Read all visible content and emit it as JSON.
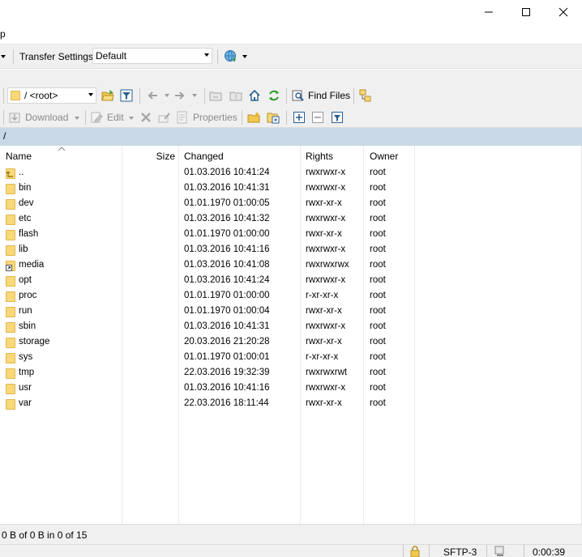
{
  "window": {
    "minimize_icon": "minimize-icon",
    "maximize_icon": "maximize-icon",
    "close_icon": "close-icon"
  },
  "menu": {
    "fragment": "p"
  },
  "toolbar_top": {
    "transfer_settings_label": "Transfer Settings",
    "transfer_preset": "Default"
  },
  "nav_toolbar": {
    "path_combo": "/ <root>",
    "find_files_label": "Find Files"
  },
  "file_toolbar": {
    "download_label": "Download",
    "edit_label": "Edit",
    "properties_label": "Properties"
  },
  "current_path": "/",
  "columns": {
    "name": "Name",
    "size": "Size",
    "changed": "Changed",
    "rights": "Rights",
    "owner": "Owner"
  },
  "files": [
    {
      "name": "..",
      "size": "",
      "changed": "01.03.2016 10:41:24",
      "rights": "rwxrwxr-x",
      "owner": "root",
      "kind": "parent"
    },
    {
      "name": "bin",
      "size": "",
      "changed": "01.03.2016 10:41:31",
      "rights": "rwxrwxr-x",
      "owner": "root",
      "kind": "folder"
    },
    {
      "name": "dev",
      "size": "",
      "changed": "01.01.1970 01:00:05",
      "rights": "rwxr-xr-x",
      "owner": "root",
      "kind": "folder"
    },
    {
      "name": "etc",
      "size": "",
      "changed": "01.03.2016 10:41:32",
      "rights": "rwxrwxr-x",
      "owner": "root",
      "kind": "folder"
    },
    {
      "name": "flash",
      "size": "",
      "changed": "01.01.1970 01:00:00",
      "rights": "rwxr-xr-x",
      "owner": "root",
      "kind": "folder"
    },
    {
      "name": "lib",
      "size": "",
      "changed": "01.03.2016 10:41:16",
      "rights": "rwxrwxr-x",
      "owner": "root",
      "kind": "folder"
    },
    {
      "name": "media",
      "size": "",
      "changed": "01.03.2016 10:41:08",
      "rights": "rwxrwxrwx",
      "owner": "root",
      "kind": "link"
    },
    {
      "name": "opt",
      "size": "",
      "changed": "01.03.2016 10:41:24",
      "rights": "rwxrwxr-x",
      "owner": "root",
      "kind": "folder"
    },
    {
      "name": "proc",
      "size": "",
      "changed": "01.01.1970 01:00:00",
      "rights": "r-xr-xr-x",
      "owner": "root",
      "kind": "folder"
    },
    {
      "name": "run",
      "size": "",
      "changed": "01.01.1970 01:00:04",
      "rights": "rwxr-xr-x",
      "owner": "root",
      "kind": "folder"
    },
    {
      "name": "sbin",
      "size": "",
      "changed": "01.03.2016 10:41:31",
      "rights": "rwxrwxr-x",
      "owner": "root",
      "kind": "folder"
    },
    {
      "name": "storage",
      "size": "",
      "changed": "20.03.2016 21:20:28",
      "rights": "rwxr-xr-x",
      "owner": "root",
      "kind": "folder"
    },
    {
      "name": "sys",
      "size": "",
      "changed": "01.01.1970 01:00:01",
      "rights": "r-xr-xr-x",
      "owner": "root",
      "kind": "folder"
    },
    {
      "name": "tmp",
      "size": "",
      "changed": "22.03.2016 19:32:39",
      "rights": "rwxrwxrwt",
      "owner": "root",
      "kind": "folder"
    },
    {
      "name": "usr",
      "size": "",
      "changed": "01.03.2016 10:41:16",
      "rights": "rwxrwxr-x",
      "owner": "root",
      "kind": "folder"
    },
    {
      "name": "var",
      "size": "",
      "changed": "22.03.2016 18:11:44",
      "rights": "rwxr-xr-x",
      "owner": "root",
      "kind": "folder"
    }
  ],
  "status": {
    "selection": "0 B of 0 B in 0 of 15",
    "protocol": "SFTP-3",
    "elapsed": "0:00:39"
  },
  "colors": {
    "path_bar": "#c8d8e6",
    "folder": "#f8d878",
    "toolbar_bg": "#f0f0f0"
  }
}
